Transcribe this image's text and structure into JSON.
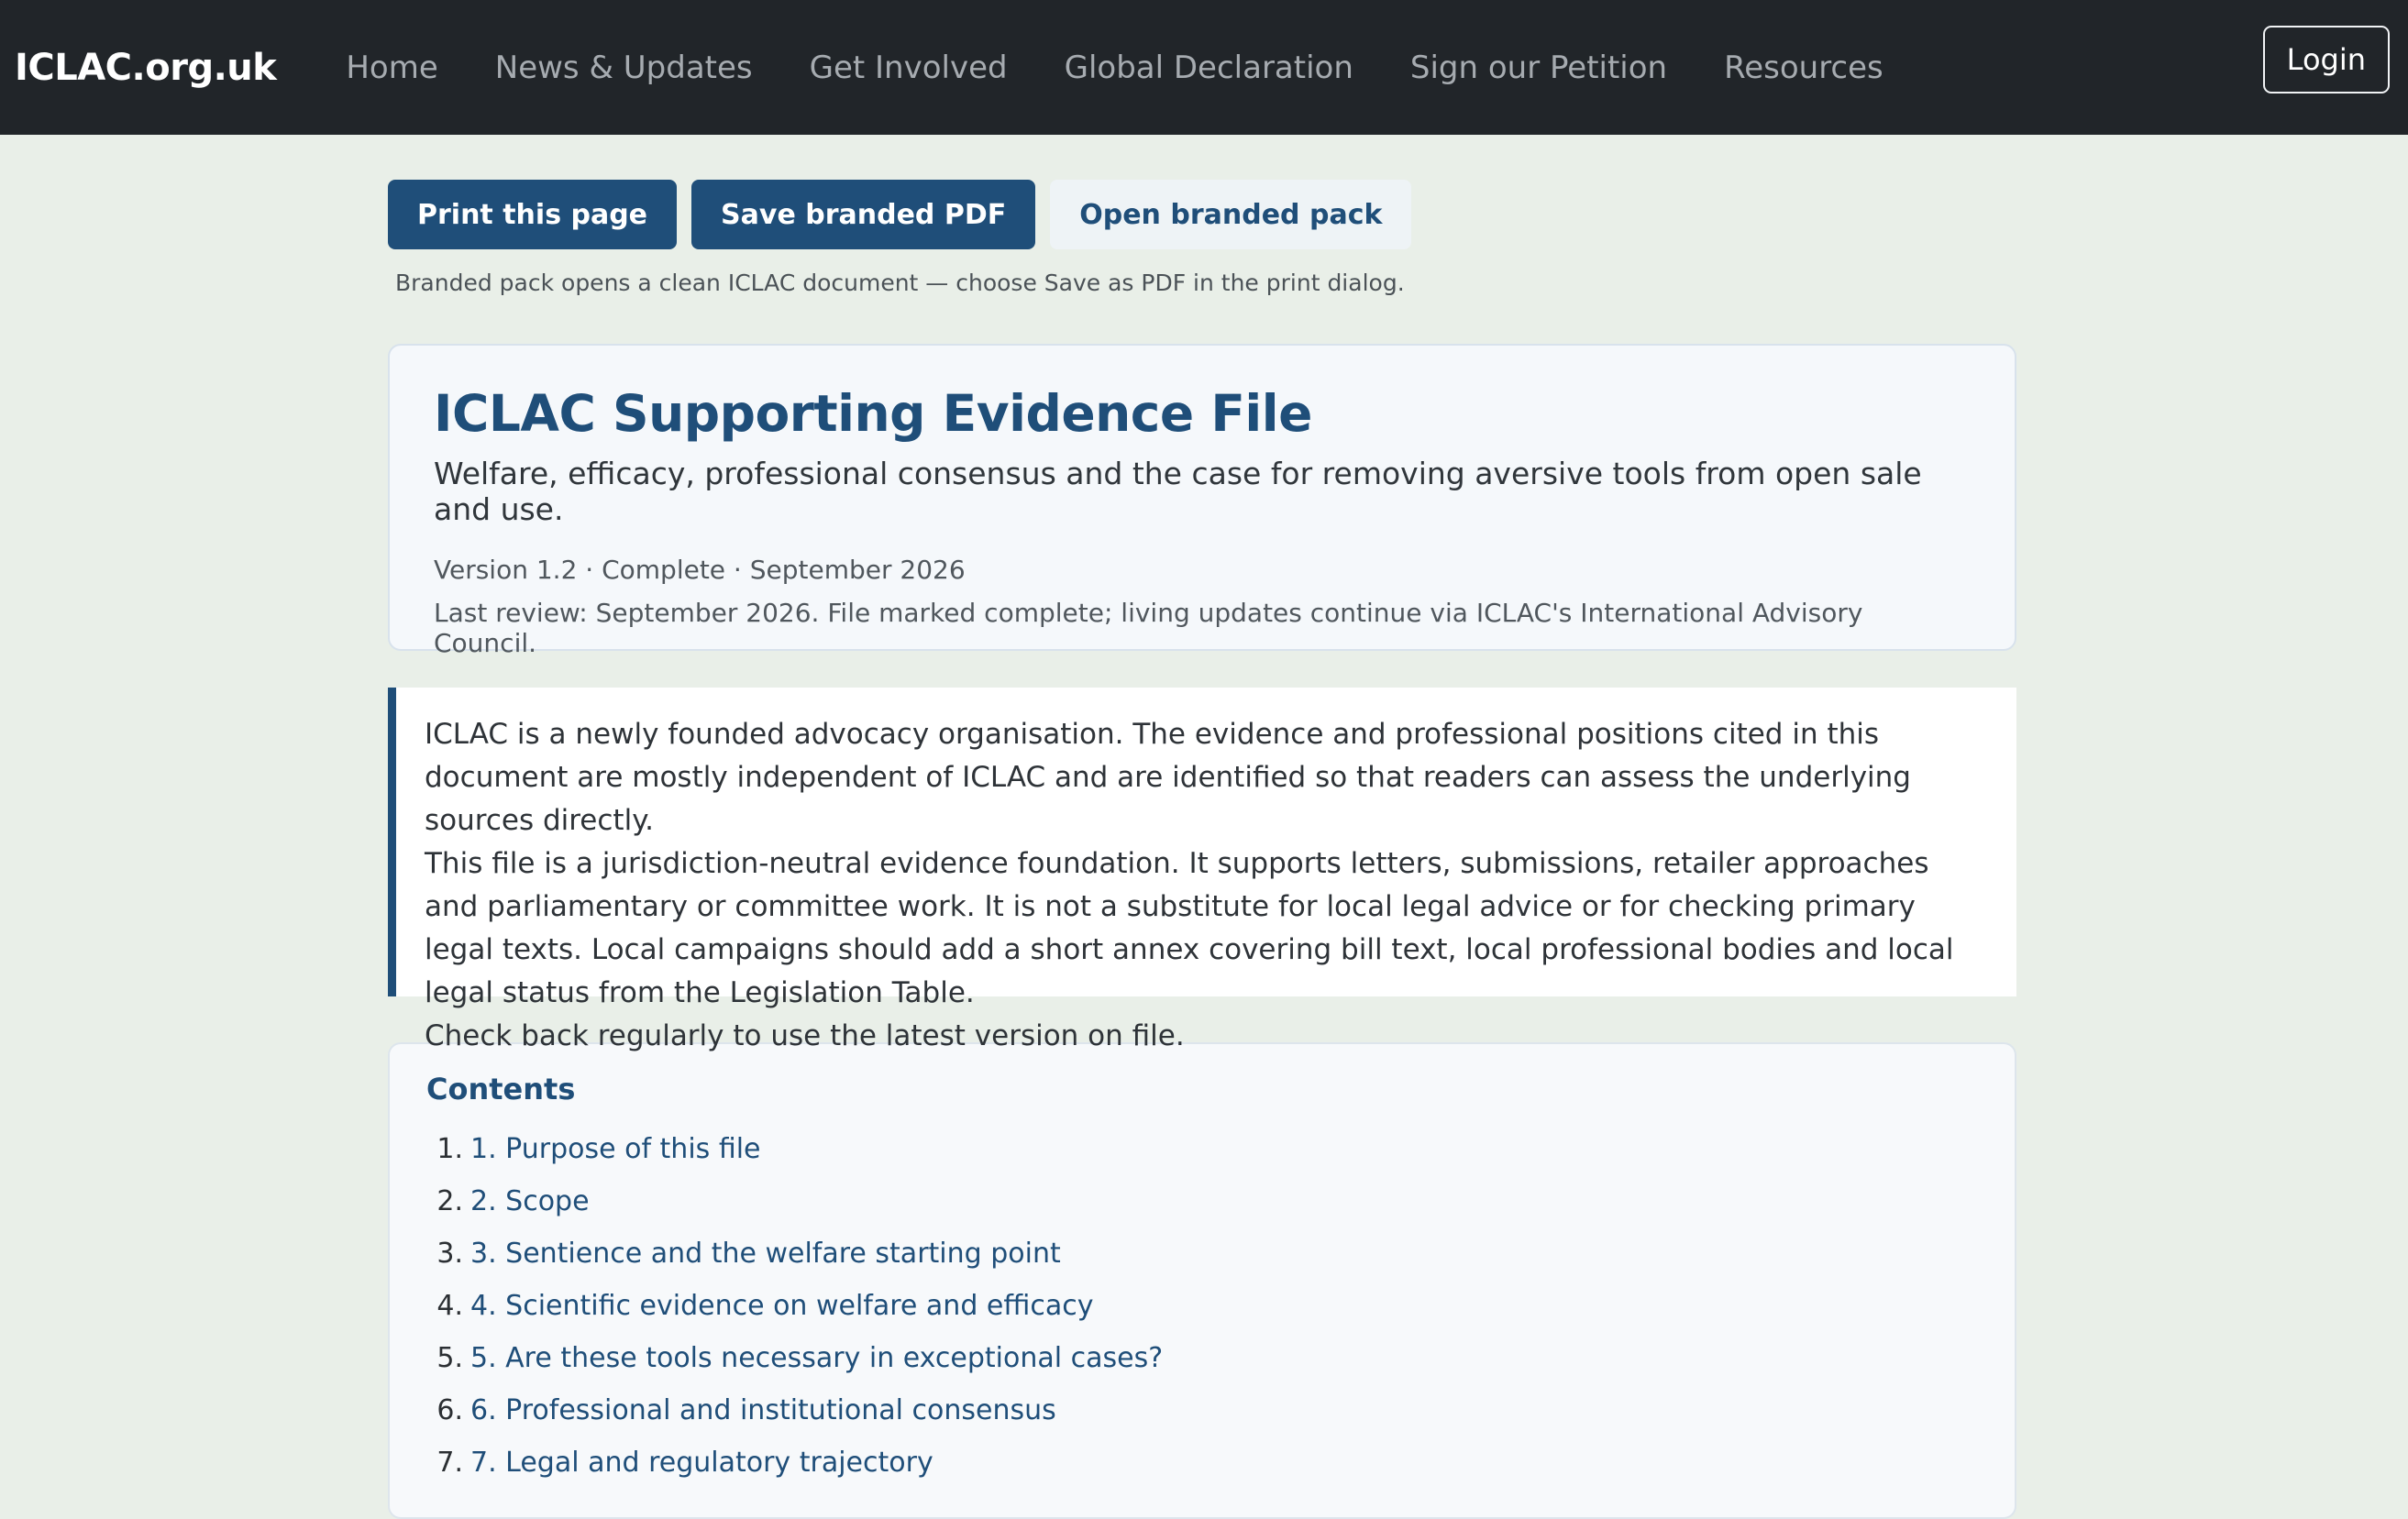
{
  "navbar": {
    "brand": "ICLAC.org.uk",
    "links": [
      "Home",
      "News & Updates",
      "Get Involved",
      "Global Declaration",
      "Sign our Petition",
      "Resources"
    ],
    "login_label": "Login"
  },
  "toolbar": {
    "print_label": "Print this page",
    "save_pdf_label": "Save branded PDF",
    "open_pack_label": "Open branded pack",
    "note": "Branded pack opens a clean ICLAC document — choose Save as PDF in the print dialog."
  },
  "hero": {
    "title": "ICLAC Supporting Evidence File",
    "subtitle": "Welfare, efficacy, professional consensus and the case for removing aversive tools from open sale and use.",
    "meta": "Version 1.2 · Complete · September 2026",
    "review": "Last review: September 2026. File marked complete; living updates continue via ICLAC's International Advisory Council."
  },
  "notice": {
    "paragraph1": "ICLAC is a newly founded advocacy organisation. The evidence and professional positions cited in this document are mostly independent of ICLAC and are identified so that readers can assess the underlying sources directly.",
    "paragraph2": "This file is a jurisdiction-neutral evidence foundation. It supports letters, submissions, retailer approaches and parliamentary or committee work. It is not a substitute for local legal advice or for checking primary legal texts. Local campaigns should add a short annex covering bill text, local professional bodies and local legal status from the Legislation Table.",
    "paragraph3": "Check back regularly to use the latest version on file."
  },
  "contents": {
    "title": "Contents",
    "items": [
      {
        "num": "1.",
        "label": "1. Purpose of this file"
      },
      {
        "num": "2.",
        "label": "2. Scope"
      },
      {
        "num": "3.",
        "label": "3. Sentience and the welfare starting point"
      },
      {
        "num": "4.",
        "label": "4. Scientific evidence on welfare and efficacy"
      },
      {
        "num": "5.",
        "label": "5. Are these tools necessary in exceptional cases?"
      },
      {
        "num": "6.",
        "label": "6. Professional and institutional consensus"
      },
      {
        "num": "7.",
        "label": "7. Legal and regulatory trajectory"
      }
    ]
  }
}
